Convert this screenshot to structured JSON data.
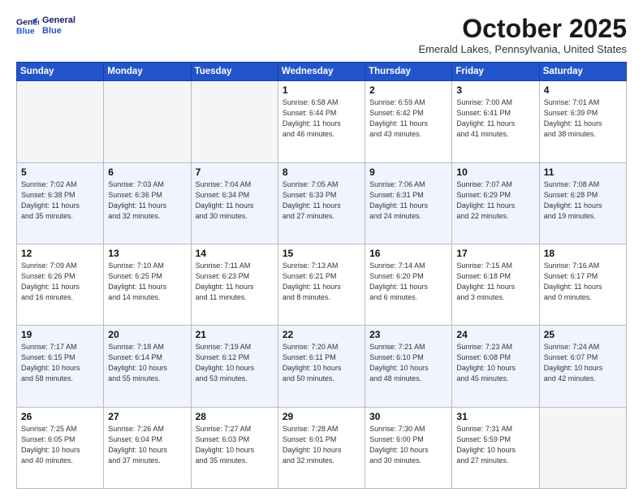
{
  "logo": {
    "line1": "General",
    "line2": "Blue"
  },
  "title": "October 2025",
  "subtitle": "Emerald Lakes, Pennsylvania, United States",
  "days_header": [
    "Sunday",
    "Monday",
    "Tuesday",
    "Wednesday",
    "Thursday",
    "Friday",
    "Saturday"
  ],
  "weeks": [
    [
      {
        "num": "",
        "info": ""
      },
      {
        "num": "",
        "info": ""
      },
      {
        "num": "",
        "info": ""
      },
      {
        "num": "1",
        "info": "Sunrise: 6:58 AM\nSunset: 6:44 PM\nDaylight: 11 hours\nand 46 minutes."
      },
      {
        "num": "2",
        "info": "Sunrise: 6:59 AM\nSunset: 6:42 PM\nDaylight: 11 hours\nand 43 minutes."
      },
      {
        "num": "3",
        "info": "Sunrise: 7:00 AM\nSunset: 6:41 PM\nDaylight: 11 hours\nand 41 minutes."
      },
      {
        "num": "4",
        "info": "Sunrise: 7:01 AM\nSunset: 6:39 PM\nDaylight: 11 hours\nand 38 minutes."
      }
    ],
    [
      {
        "num": "5",
        "info": "Sunrise: 7:02 AM\nSunset: 6:38 PM\nDaylight: 11 hours\nand 35 minutes."
      },
      {
        "num": "6",
        "info": "Sunrise: 7:03 AM\nSunset: 6:36 PM\nDaylight: 11 hours\nand 32 minutes."
      },
      {
        "num": "7",
        "info": "Sunrise: 7:04 AM\nSunset: 6:34 PM\nDaylight: 11 hours\nand 30 minutes."
      },
      {
        "num": "8",
        "info": "Sunrise: 7:05 AM\nSunset: 6:33 PM\nDaylight: 11 hours\nand 27 minutes."
      },
      {
        "num": "9",
        "info": "Sunrise: 7:06 AM\nSunset: 6:31 PM\nDaylight: 11 hours\nand 24 minutes."
      },
      {
        "num": "10",
        "info": "Sunrise: 7:07 AM\nSunset: 6:29 PM\nDaylight: 11 hours\nand 22 minutes."
      },
      {
        "num": "11",
        "info": "Sunrise: 7:08 AM\nSunset: 6:28 PM\nDaylight: 11 hours\nand 19 minutes."
      }
    ],
    [
      {
        "num": "12",
        "info": "Sunrise: 7:09 AM\nSunset: 6:26 PM\nDaylight: 11 hours\nand 16 minutes."
      },
      {
        "num": "13",
        "info": "Sunrise: 7:10 AM\nSunset: 6:25 PM\nDaylight: 11 hours\nand 14 minutes."
      },
      {
        "num": "14",
        "info": "Sunrise: 7:11 AM\nSunset: 6:23 PM\nDaylight: 11 hours\nand 11 minutes."
      },
      {
        "num": "15",
        "info": "Sunrise: 7:13 AM\nSunset: 6:21 PM\nDaylight: 11 hours\nand 8 minutes."
      },
      {
        "num": "16",
        "info": "Sunrise: 7:14 AM\nSunset: 6:20 PM\nDaylight: 11 hours\nand 6 minutes."
      },
      {
        "num": "17",
        "info": "Sunrise: 7:15 AM\nSunset: 6:18 PM\nDaylight: 11 hours\nand 3 minutes."
      },
      {
        "num": "18",
        "info": "Sunrise: 7:16 AM\nSunset: 6:17 PM\nDaylight: 11 hours\nand 0 minutes."
      }
    ],
    [
      {
        "num": "19",
        "info": "Sunrise: 7:17 AM\nSunset: 6:15 PM\nDaylight: 10 hours\nand 58 minutes."
      },
      {
        "num": "20",
        "info": "Sunrise: 7:18 AM\nSunset: 6:14 PM\nDaylight: 10 hours\nand 55 minutes."
      },
      {
        "num": "21",
        "info": "Sunrise: 7:19 AM\nSunset: 6:12 PM\nDaylight: 10 hours\nand 53 minutes."
      },
      {
        "num": "22",
        "info": "Sunrise: 7:20 AM\nSunset: 6:11 PM\nDaylight: 10 hours\nand 50 minutes."
      },
      {
        "num": "23",
        "info": "Sunrise: 7:21 AM\nSunset: 6:10 PM\nDaylight: 10 hours\nand 48 minutes."
      },
      {
        "num": "24",
        "info": "Sunrise: 7:23 AM\nSunset: 6:08 PM\nDaylight: 10 hours\nand 45 minutes."
      },
      {
        "num": "25",
        "info": "Sunrise: 7:24 AM\nSunset: 6:07 PM\nDaylight: 10 hours\nand 42 minutes."
      }
    ],
    [
      {
        "num": "26",
        "info": "Sunrise: 7:25 AM\nSunset: 6:05 PM\nDaylight: 10 hours\nand 40 minutes."
      },
      {
        "num": "27",
        "info": "Sunrise: 7:26 AM\nSunset: 6:04 PM\nDaylight: 10 hours\nand 37 minutes."
      },
      {
        "num": "28",
        "info": "Sunrise: 7:27 AM\nSunset: 6:03 PM\nDaylight: 10 hours\nand 35 minutes."
      },
      {
        "num": "29",
        "info": "Sunrise: 7:28 AM\nSunset: 6:01 PM\nDaylight: 10 hours\nand 32 minutes."
      },
      {
        "num": "30",
        "info": "Sunrise: 7:30 AM\nSunset: 6:00 PM\nDaylight: 10 hours\nand 30 minutes."
      },
      {
        "num": "31",
        "info": "Sunrise: 7:31 AM\nSunset: 5:59 PM\nDaylight: 10 hours\nand 27 minutes."
      },
      {
        "num": "",
        "info": ""
      }
    ]
  ]
}
